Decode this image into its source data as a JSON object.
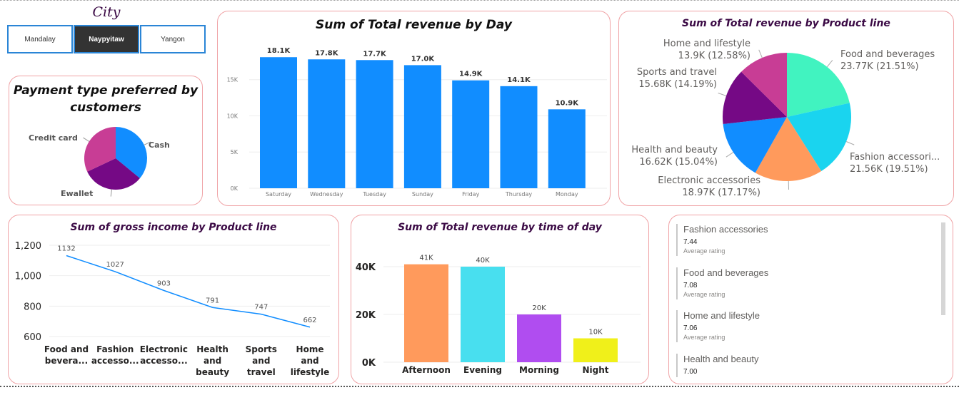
{
  "city_slicer": {
    "title": "City",
    "options": [
      "Mandalay",
      "Naypyitaw",
      "Yangon"
    ],
    "selected": "Naypyitaw"
  },
  "payment_chart": {
    "title_line1": "Payment type preferred by",
    "title_line2": "customers",
    "chart_data": {
      "type": "pie",
      "slices": [
        {
          "label": "Cash",
          "value": 36,
          "color": "#118dff"
        },
        {
          "label": "Ewallet",
          "value": 32,
          "color": "#750985"
        },
        {
          "label": "Credit card",
          "value": 32,
          "color": "#c83d95"
        }
      ]
    }
  },
  "day_chart": {
    "title": "Sum of Total revenue by Day",
    "color": "#118dff",
    "chart_data": {
      "type": "bar",
      "categories": [
        "Saturday",
        "Wednesday",
        "Tuesday",
        "Sunday",
        "Friday",
        "Thursday",
        "Monday"
      ],
      "values": [
        18100,
        17800,
        17700,
        17000,
        14900,
        14100,
        10900
      ],
      "data_labels": [
        "18.1K",
        "17.8K",
        "17.7K",
        "17.0K",
        "14.9K",
        "14.1K",
        "10.9K"
      ],
      "yticks": [
        "0K",
        "5K",
        "10K",
        "15K"
      ],
      "ylim": [
        0,
        19500
      ],
      "grid": true
    }
  },
  "product_pie": {
    "title": "Sum of Total revenue by Product line",
    "chart_data": {
      "type": "pie",
      "slices": [
        {
          "name": "Food and beverages",
          "value_text": "23.77K (21.51%)",
          "value": 21.51,
          "color": "#41f3c0"
        },
        {
          "name": "Fashion accessori...",
          "value_text": "21.56K (19.51%)",
          "value": 19.51,
          "color": "#1ad4ef"
        },
        {
          "name": "Electronic accessories",
          "value_text": "18.97K (17.17%)",
          "value": 17.17,
          "color": "#ff9a5c"
        },
        {
          "name": "Health and beauty",
          "value_text": "16.62K (15.04%)",
          "value": 15.04,
          "color": "#118dff"
        },
        {
          "name": "Sports and travel",
          "value_text": "15.68K (14.19%)",
          "value": 14.19,
          "color": "#750985"
        },
        {
          "name": "Home and lifestyle",
          "value_text": "13.9K (12.58%)",
          "value": 12.58,
          "color": "#c83d95"
        }
      ]
    }
  },
  "gross_chart": {
    "title": "Sum of gross income by Product line",
    "color": "#118dff",
    "chart_data": {
      "type": "line",
      "categories": [
        [
          "Food and",
          "bevera..."
        ],
        [
          "Fashion",
          "accesso..."
        ],
        [
          "Electronic",
          "accesso..."
        ],
        [
          "Health",
          "and",
          "beauty"
        ],
        [
          "Sports",
          "and",
          "travel"
        ],
        [
          "Home",
          "and",
          "lifestyle"
        ]
      ],
      "values": [
        1132,
        1027,
        903,
        791,
        747,
        662
      ],
      "data_labels": [
        "1132",
        "1027",
        "903",
        "791",
        "747",
        "662"
      ],
      "yticks": [
        600,
        800,
        1000,
        1200
      ],
      "ytick_labels": [
        "600",
        "800",
        "1,000",
        "1,200"
      ],
      "ylim": [
        600,
        1200
      ],
      "grid": true
    }
  },
  "time_chart": {
    "title": "Sum of Total revenue by time of day",
    "chart_data": {
      "type": "bar",
      "categories": [
        "Afternoon",
        "Evening",
        "Morning",
        "Night"
      ],
      "values": [
        41000,
        40000,
        20000,
        10000
      ],
      "data_labels": [
        "41K",
        "40K",
        "20K",
        "10K"
      ],
      "colors": [
        "#ff9a5c",
        "#48dfef",
        "#b04df0",
        "#f0f01a"
      ],
      "yticks": [
        0,
        20000,
        40000
      ],
      "ytick_labels": [
        "0K",
        "20K",
        "40K"
      ],
      "ylim": [
        0,
        40000
      ],
      "grid": true
    }
  },
  "ratings": {
    "items": [
      {
        "name": "Fashion accessories",
        "value": "7.44",
        "label": "Average rating"
      },
      {
        "name": "Food and beverages",
        "value": "7.08",
        "label": "Average rating"
      },
      {
        "name": "Home and lifestyle",
        "value": "7.06",
        "label": "Average rating"
      },
      {
        "name": "Health and beauty",
        "value": "7.00",
        "label": ""
      }
    ]
  }
}
